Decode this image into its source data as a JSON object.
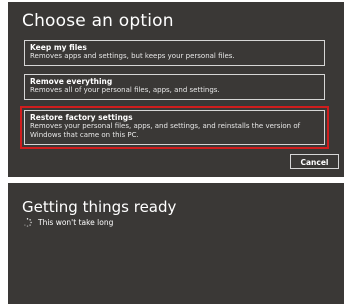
{
  "choose_panel": {
    "title": "Choose an option",
    "options": [
      {
        "title": "Keep my files",
        "description": "Removes apps and settings, but keeps your personal files."
      },
      {
        "title": "Remove everything",
        "description": "Removes all of your personal files, apps, and settings."
      },
      {
        "title": "Restore factory settings",
        "description": "Removes your personal files, apps, and settings, and reinstalls the version of Windows that came on this PC."
      }
    ],
    "cancel_label": "Cancel",
    "highlight_color": "#d01d1d",
    "background_color": "#3a3836"
  },
  "ready_panel": {
    "title": "Getting things ready",
    "status": "This won't take long",
    "spinner_icon": "loading-spinner-icon"
  }
}
